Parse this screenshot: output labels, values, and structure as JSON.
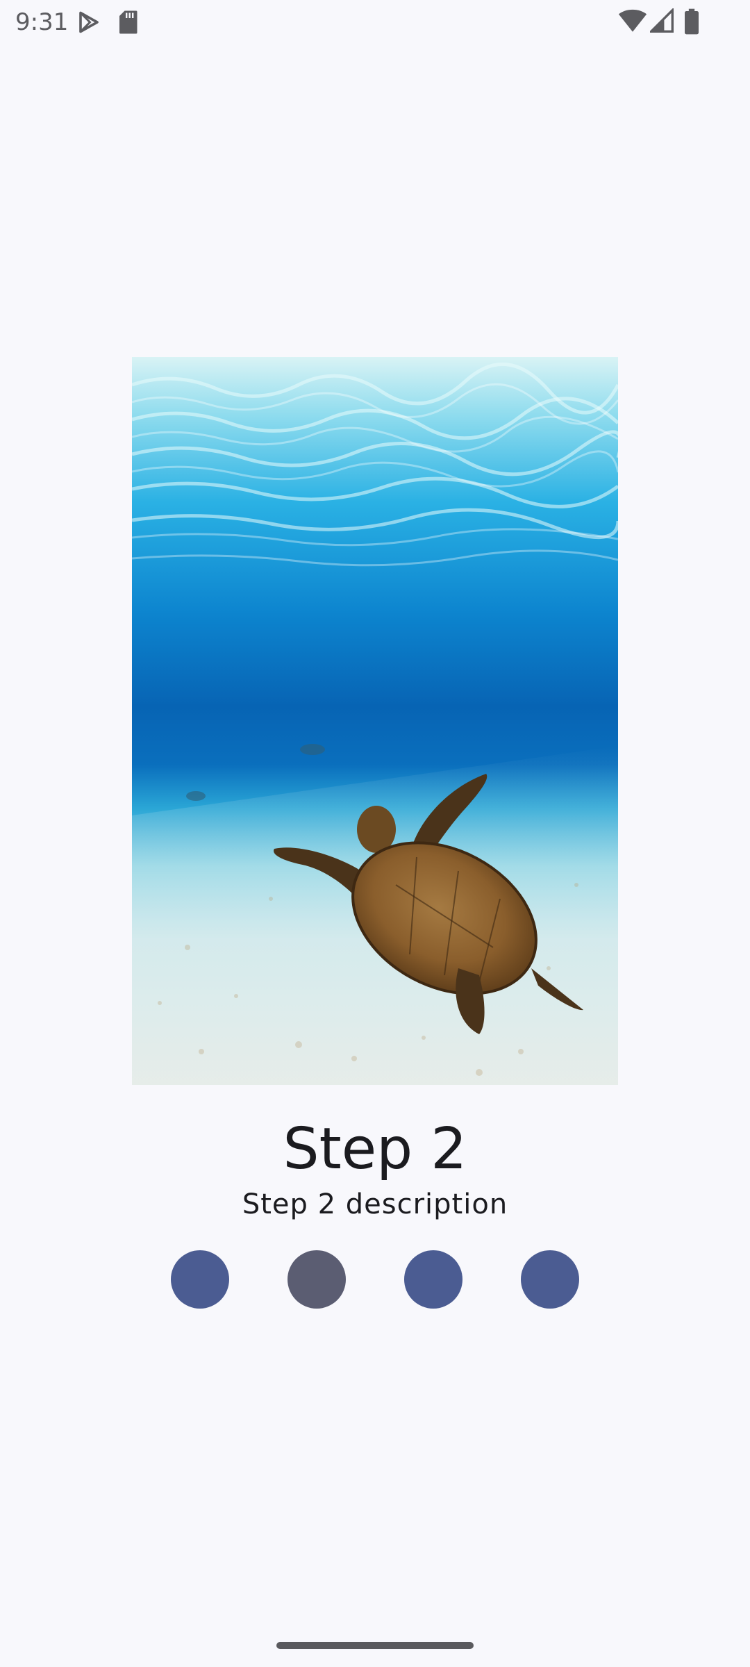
{
  "status_bar": {
    "time": "9:31",
    "icons_left": [
      "play-store-icon",
      "sd-card-icon"
    ],
    "icons_right": [
      "wifi-icon",
      "signal-icon",
      "battery-icon"
    ]
  },
  "hero_image": {
    "alt": "sea-turtle-underwater-photo"
  },
  "step": {
    "title": "Step 2",
    "description": "Step 2 description"
  },
  "pager": {
    "total": 4,
    "current_index": 1,
    "active_color": "#5b5d72",
    "inactive_color": "#4b5c92"
  }
}
